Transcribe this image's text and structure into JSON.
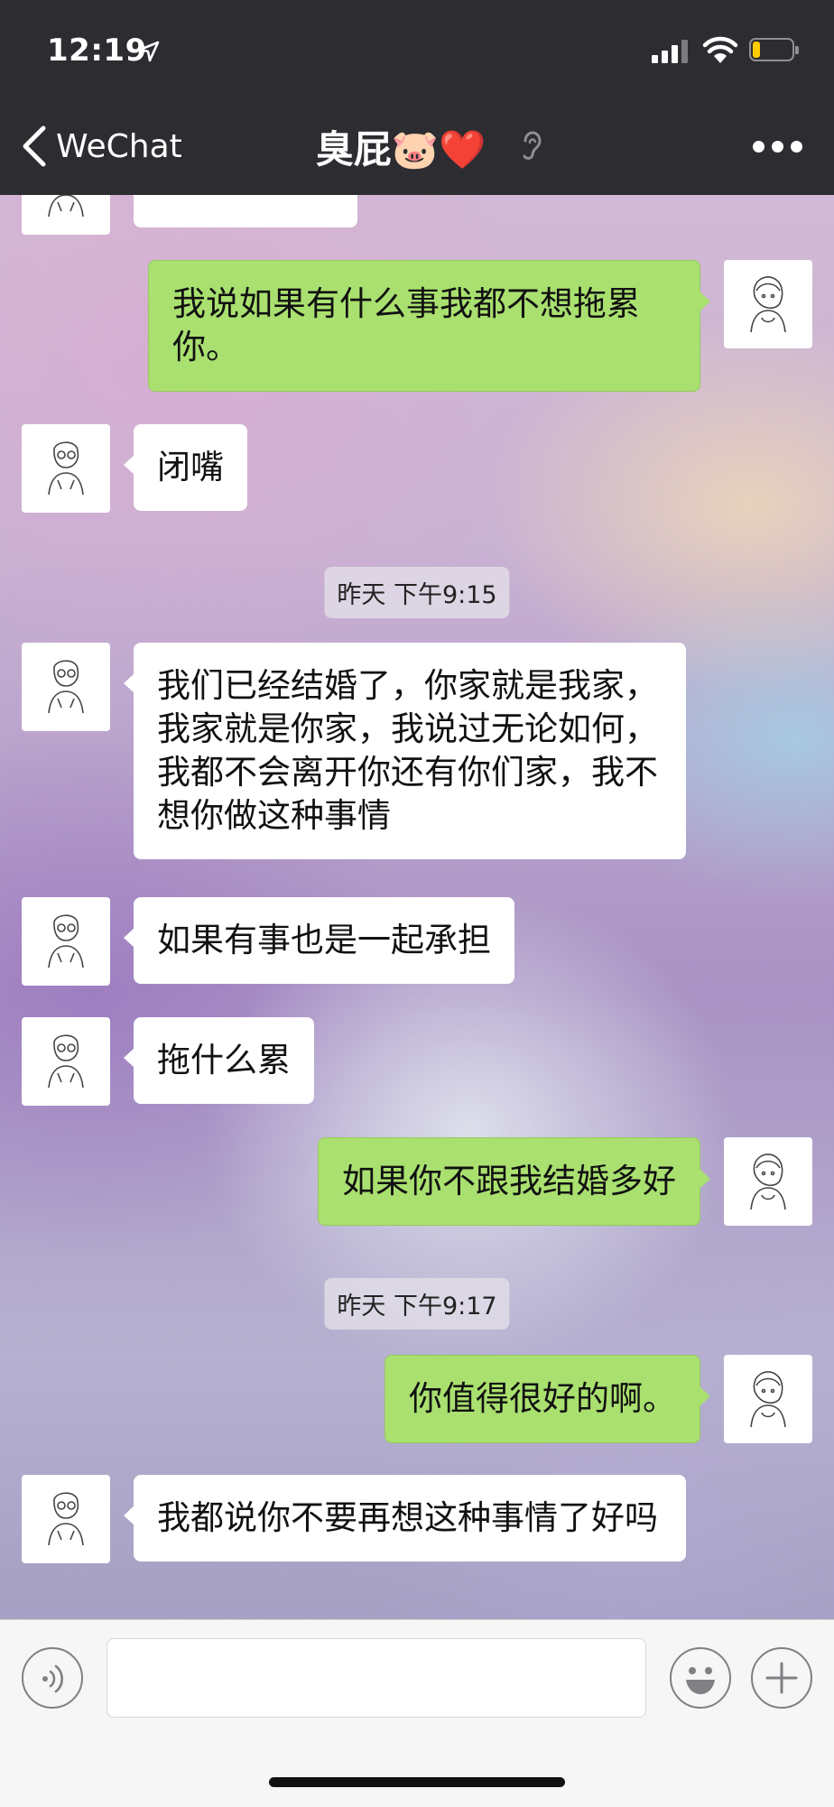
{
  "status_bar": {
    "time": "12:19",
    "icons": [
      "location-arrow-icon",
      "cellular-signal-icon",
      "wifi-icon",
      "battery-icon"
    ],
    "battery_level": 0.2,
    "battery_color": "#ffcc00"
  },
  "nav": {
    "back_label": "WeChat",
    "title": "臭屁🐷❤️",
    "icons": [
      "back-chevron-icon",
      "ear-icon",
      "more-icon"
    ]
  },
  "colors": {
    "header_bg": "#2c2c31",
    "outgoing_bubble": "#a9e06f",
    "incoming_bubble": "#ffffff",
    "input_bar_bg": "#f6f6f6"
  },
  "messages": [
    {
      "side": "out",
      "text": "我说如果有什么事我都不想拖累你。"
    },
    {
      "side": "in",
      "text": "闭嘴"
    },
    {
      "side": "time",
      "text": "昨天 下午9:15"
    },
    {
      "side": "in",
      "text": "我们已经结婚了，你家就是我家，我家就是你家，我说过无论如何，我都不会离开你还有你们家，我不想你做这种事情"
    },
    {
      "side": "in",
      "text": "如果有事也是一起承担"
    },
    {
      "side": "in",
      "text": "拖什么累"
    },
    {
      "side": "out",
      "text": "如果你不跟我结婚多好"
    },
    {
      "side": "time",
      "text": "昨天 下午9:17"
    },
    {
      "side": "out",
      "text": "你值得很好的啊。"
    },
    {
      "side": "in",
      "text": "我都说你不要再想这种事情了好吗"
    }
  ],
  "input_bar": {
    "value": "",
    "icons": [
      "voice-icon",
      "emoji-icon",
      "plus-icon"
    ]
  }
}
